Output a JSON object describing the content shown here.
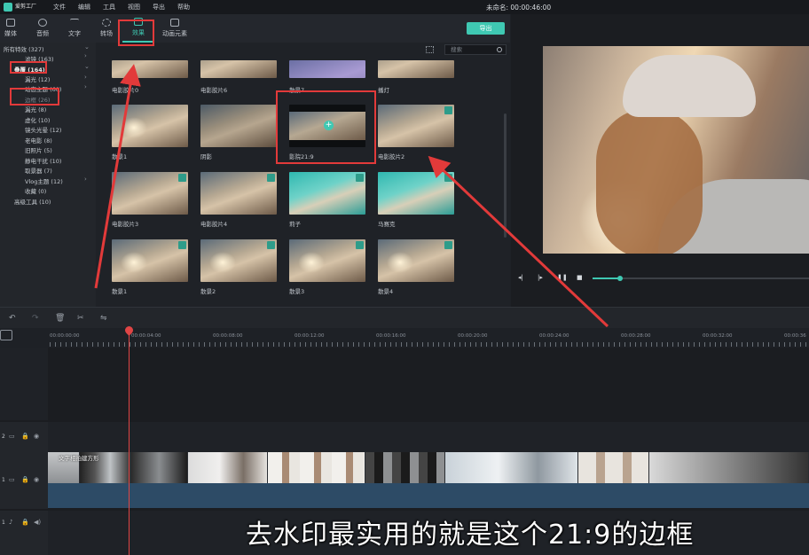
{
  "app": {
    "logo_text": "爱剪工厂",
    "menu": [
      "文件",
      "编辑",
      "工具",
      "视图",
      "导出",
      "帮助"
    ],
    "document_title": "未命名: 00:00:46:00"
  },
  "tabs": [
    {
      "label": "媒体",
      "icon": "folder-icon"
    },
    {
      "label": "音频",
      "icon": "music-note-icon"
    },
    {
      "label": "文字",
      "icon": "text-icon"
    },
    {
      "label": "转场",
      "icon": "transition-icon"
    },
    {
      "label": "效果",
      "icon": "effects-icon",
      "active": true
    },
    {
      "label": "动画元素",
      "icon": "image-icon"
    }
  ],
  "export_label": "导出",
  "categories": [
    {
      "label": "所有特效 (327)"
    },
    {
      "label": "滤镜 (163)"
    },
    {
      "label": "叠覆 (164)",
      "selected": true
    },
    {
      "label": "漏光 (12)"
    },
    {
      "label": "动态主题 (60)"
    },
    {
      "label": "边框 (26)",
      "dim": true
    },
    {
      "label": "漏光 (8)"
    },
    {
      "label": "虚化 (10)"
    },
    {
      "label": "镜头光晕 (12)"
    },
    {
      "label": "老电影 (8)"
    },
    {
      "label": "旧照片 (5)"
    },
    {
      "label": "静电干扰 (10)"
    },
    {
      "label": "取景器 (7)"
    },
    {
      "label": "Vlog主题 (12)"
    },
    {
      "label": "收藏 (0)"
    },
    {
      "label": "高级工具 (10)"
    }
  ],
  "search": {
    "placeholder": "搜索"
  },
  "effects": [
    {
      "label": "电影胶片0",
      "style": "normal"
    },
    {
      "label": "电影胶片6",
      "style": "normal"
    },
    {
      "label": "散景7",
      "style": "sparkle"
    },
    {
      "label": "播灯",
      "style": "normal"
    },
    {
      "label": "散景1",
      "style": "normal"
    },
    {
      "label": "阴影",
      "style": "normal"
    },
    {
      "label": "影院21:9",
      "style": "frame"
    },
    {
      "label": "电影胶片2",
      "style": "normal"
    },
    {
      "label": "电影胶片3",
      "style": "normal"
    },
    {
      "label": "电影胶片4",
      "style": "normal"
    },
    {
      "label": "莉子",
      "style": "teal"
    },
    {
      "label": "马赛克",
      "style": "teal"
    },
    {
      "label": "散景1",
      "style": "normal"
    },
    {
      "label": "散景2",
      "style": "normal"
    },
    {
      "label": "散景3",
      "style": "normal"
    },
    {
      "label": "散景4",
      "style": "normal"
    }
  ],
  "timeline": {
    "ruler_labels": [
      "00:00:00:00",
      "00:00:04:00",
      "00:00:08:00",
      "00:00:12:00",
      "00:00:16:00",
      "00:00:20:00",
      "00:00:24:00",
      "00:00:28:00",
      "00:00:32:00",
      "00:00:36"
    ],
    "tracks": [
      {
        "num": "2"
      },
      {
        "num": "1"
      },
      {
        "num": "1"
      }
    ],
    "clip_label": "文字相拍建方形"
  },
  "caption": "去水印最实用的就是这个21:9的边框",
  "colors": {
    "accent": "#3fc8b2",
    "annotation": "#e23a3a",
    "playhead": "#e04545"
  }
}
